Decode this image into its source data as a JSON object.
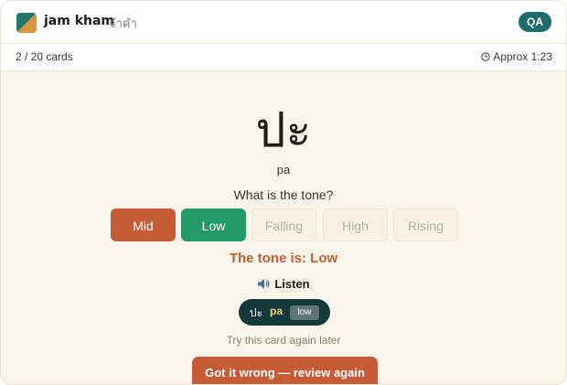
{
  "header": {
    "app_name": "jam kham",
    "app_subname": "จำคำ",
    "badge": "QA",
    "logo_icon": "jam-kham-logo",
    "colors": {
      "badge": "#1e6b6b",
      "logo_green": "#1f7a6b",
      "logo_orange": "#d9963a"
    }
  },
  "progress": {
    "count": "2 / 20 cards",
    "current": 2,
    "total": 20,
    "timer": "Approx 1:23",
    "timer_icon": "clock-icon"
  },
  "card": {
    "word": "ปะ",
    "romanization": "pa",
    "question": "What is the tone?",
    "options": [
      {
        "label": "Mid",
        "state": "wrong"
      },
      {
        "label": "Low",
        "state": "correct"
      },
      {
        "label": "Falling",
        "state": "disabled"
      },
      {
        "label": "High",
        "state": "disabled"
      },
      {
        "label": "Rising",
        "state": "disabled"
      }
    ],
    "feedback": "The tone is: Low",
    "listen_label": "Listen",
    "listen_icon": "speaker-icon",
    "audio": {
      "thai": "ปะ",
      "roman": "pa",
      "tone": "low"
    },
    "hint": "Try this card again later",
    "review_button": "Got it wrong — review again"
  },
  "colors": {
    "background": "#faf5ea",
    "wrong": "#c65b35",
    "correct": "#229b68",
    "pill": "#14393a",
    "pill_roman": "#f0cf72"
  }
}
